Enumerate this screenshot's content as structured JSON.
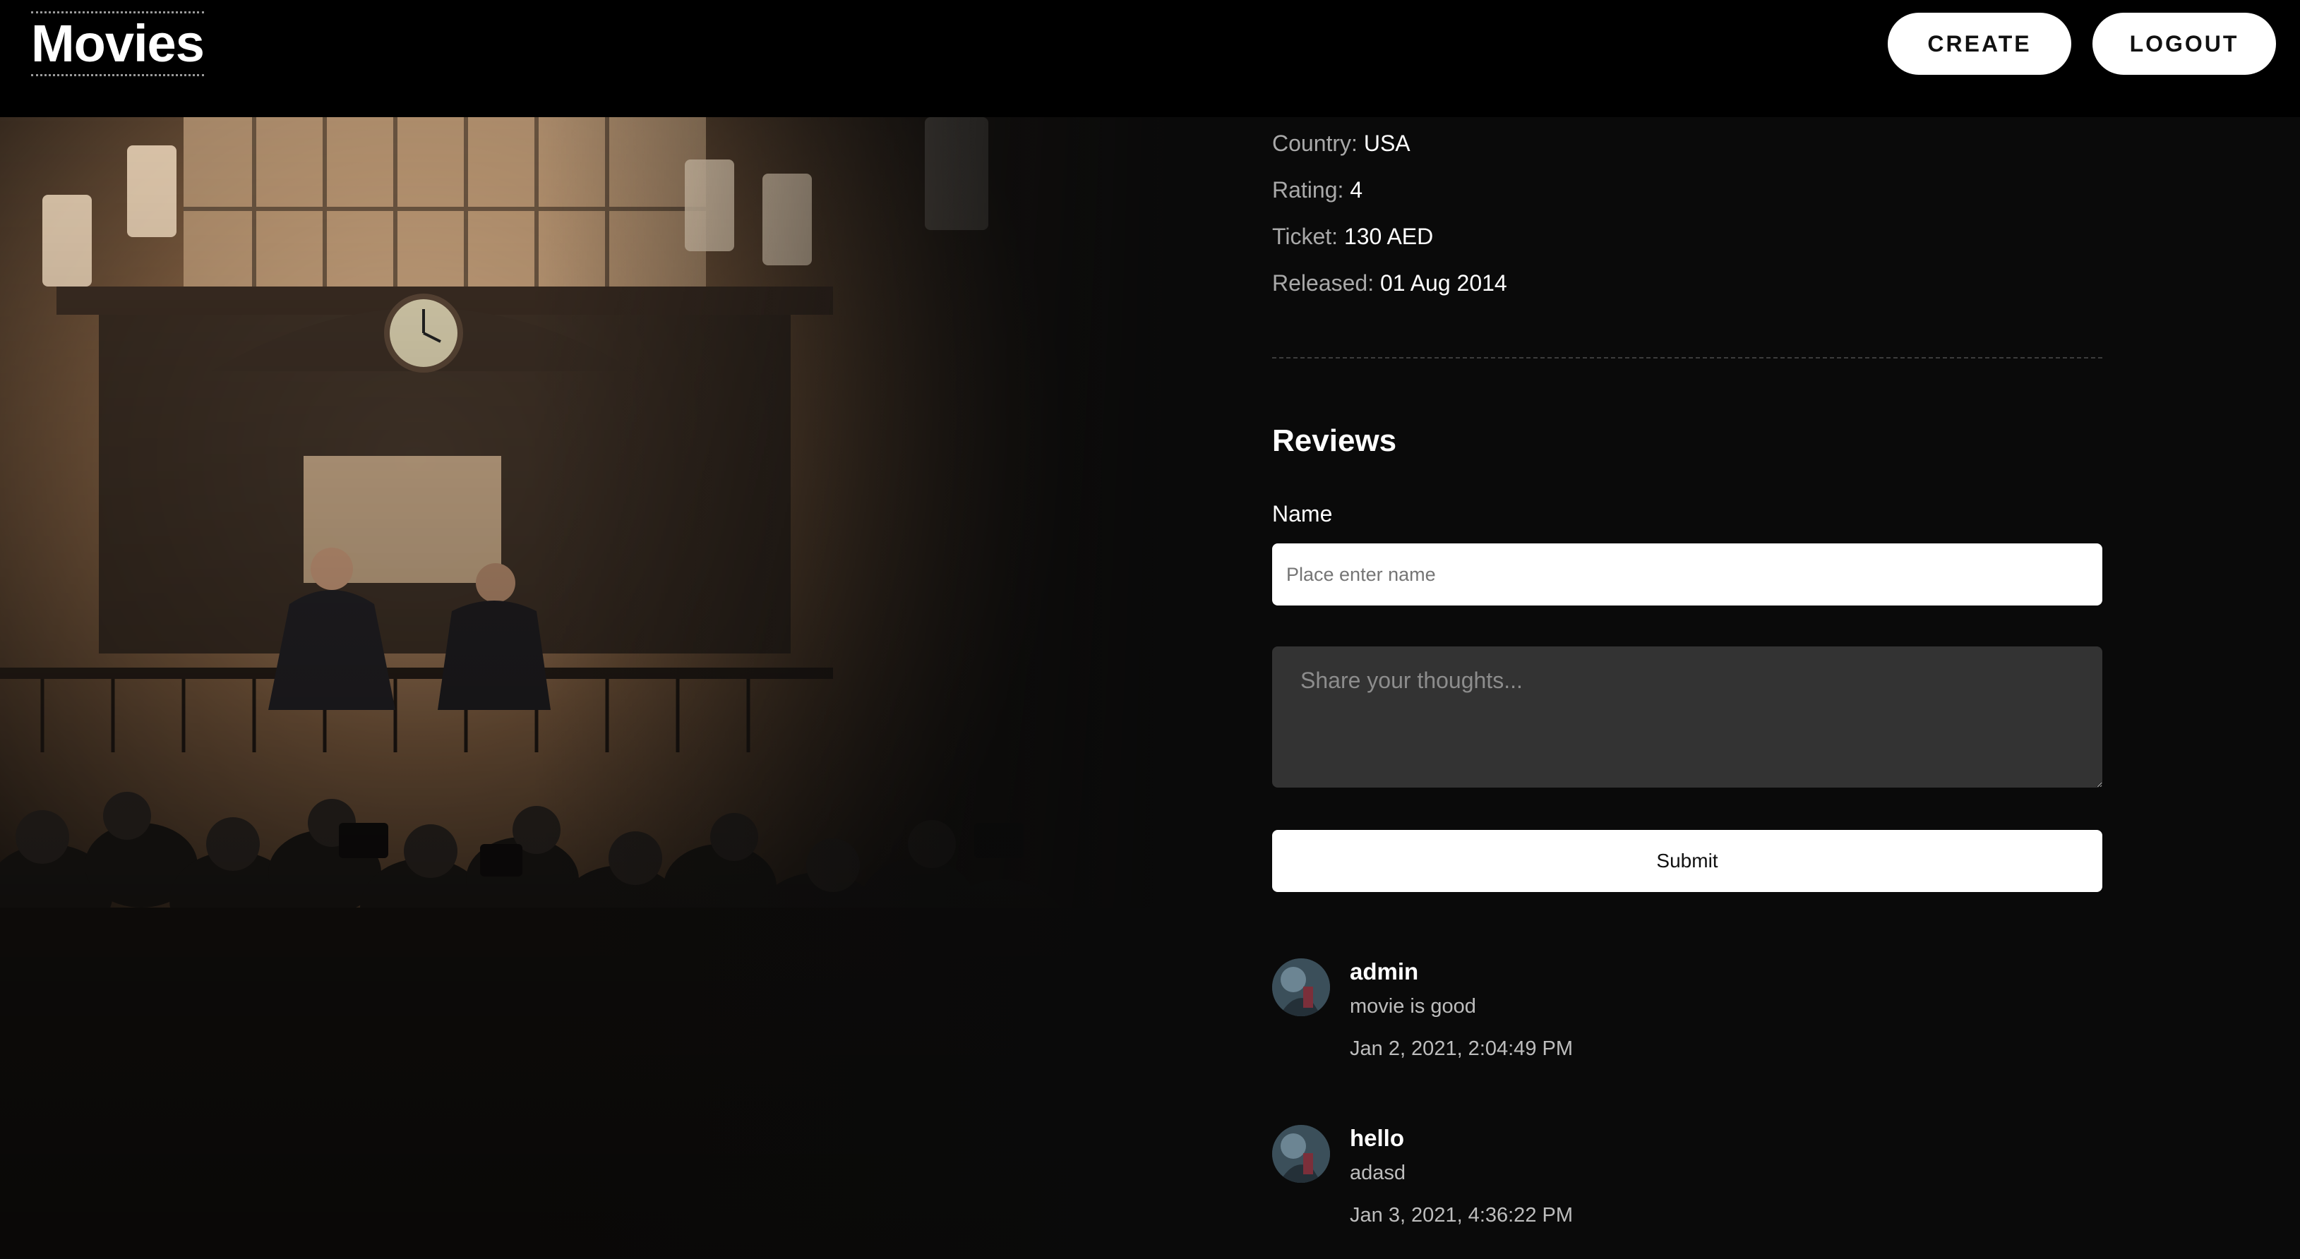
{
  "header": {
    "brand": "Movies",
    "create_label": "CREATE",
    "logout_label": "LOGOUT"
  },
  "movie": {
    "country_label": "Country:",
    "country": "USA",
    "rating_label": "Rating:",
    "rating": "4",
    "ticket_label": "Ticket:",
    "ticket": "130 AED",
    "released_label": "Released:",
    "released": "01 Aug 2014"
  },
  "reviews": {
    "title": "Reviews",
    "name_label": "Name",
    "name_placeholder": "Place enter name",
    "thoughts_placeholder": "Share your thoughts...",
    "submit_label": "Submit",
    "items": [
      {
        "author": "admin",
        "text": "movie is good",
        "date": "Jan 2, 2021, 2:04:49 PM"
      },
      {
        "author": "hello",
        "text": "adasd",
        "date": "Jan 3, 2021, 4:36:22 PM"
      }
    ]
  },
  "colors": {
    "background": "#0a0a0a",
    "header": "#000000",
    "button_bg": "#ffffff",
    "textarea_bg": "#333333",
    "muted_text": "#a9a9a9"
  }
}
